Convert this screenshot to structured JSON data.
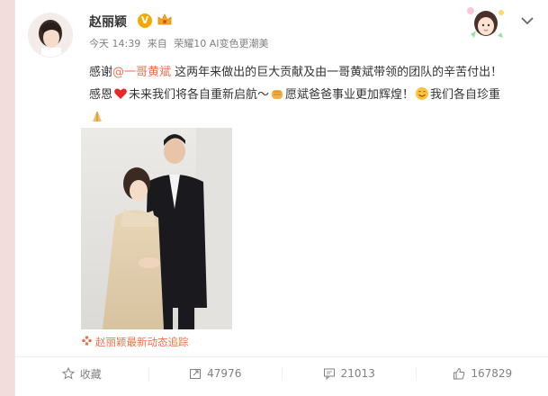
{
  "user": {
    "name": "赵丽颖",
    "verified_badge": "V"
  },
  "meta": {
    "time": "今天 14:39",
    "source_prefix": "来自",
    "source": "荣耀10 AI变色更潮美"
  },
  "post": {
    "line1_prefix": "感谢",
    "mention": "@一哥黄斌",
    "line1_suffix": " 这两年来做出的巨大贡献及由一哥黄斌带领的团队的辛苦付出！",
    "line2_a": "感恩",
    "line2_b": "未来我们将各自重新启航～",
    "line2_c": "愿斌爸爸事业更加辉煌！",
    "line2_d": "我们各自珍重"
  },
  "tracker": {
    "label": "赵丽颖最新动态追踪"
  },
  "actions": {
    "favorite_label": "收藏",
    "repost_count": "47976",
    "comment_count": "21013",
    "like_count": "167829"
  },
  "colors": {
    "accent": "#eb7350",
    "badge": "#f7a800",
    "muted": "#808080"
  },
  "icons": [
    "v-badge-icon",
    "crown-icon",
    "heart-icon",
    "fist-icon",
    "smile-icon",
    "prayer-icon",
    "favorite-star-icon",
    "repost-icon",
    "comment-icon",
    "like-icon",
    "chevron-down-icon",
    "flower-icon"
  ]
}
